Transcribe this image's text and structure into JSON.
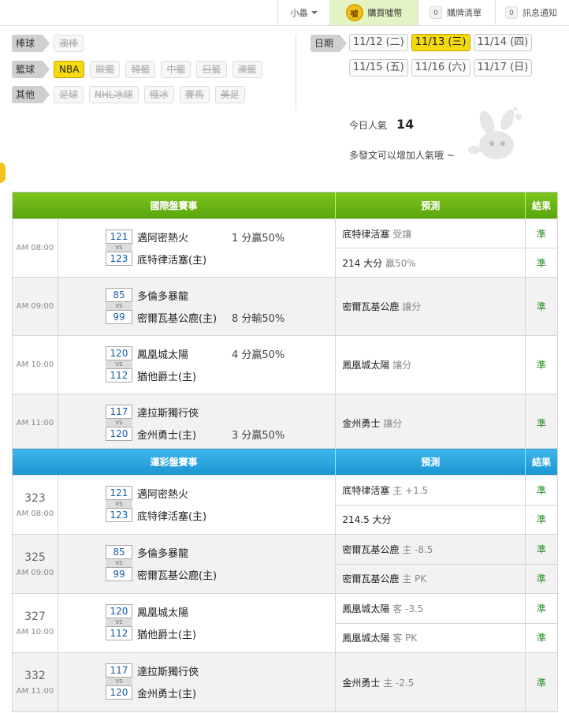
{
  "topbar": {
    "user": "小畾",
    "buy": "購買噓幣",
    "buy_coin": "噓",
    "list_count": "0",
    "list": "購牌清單",
    "msg_count": "0",
    "msg": "訊息通知"
  },
  "categories": [
    {
      "label": "棒球",
      "items": [
        {
          "t": "澳棒",
          "on": false
        }
      ]
    },
    {
      "label": "籃球",
      "items": [
        {
          "t": "NBA",
          "on": true
        },
        {
          "t": "歐籃",
          "on": false
        },
        {
          "t": "韓籃",
          "on": false
        },
        {
          "t": "中籃",
          "on": false
        },
        {
          "t": "日籃",
          "on": false
        },
        {
          "t": "澳籃",
          "on": false
        }
      ]
    },
    {
      "label": "其他",
      "items": [
        {
          "t": "足球",
          "on": false
        },
        {
          "t": "NHL冰球",
          "on": false
        },
        {
          "t": "俄冰",
          "on": false
        },
        {
          "t": "賽馬",
          "on": false
        },
        {
          "t": "美足",
          "on": false
        }
      ]
    }
  ],
  "date_label": "日期",
  "dates": [
    {
      "t": "11/12 (二)",
      "on": false
    },
    {
      "t": "11/13 (三)",
      "on": true
    },
    {
      "t": "11/14 (四)",
      "on": false
    },
    {
      "t": "11/15 (五)",
      "on": false
    },
    {
      "t": "11/16 (六)",
      "on": false
    },
    {
      "t": "11/17 (日)",
      "on": false
    }
  ],
  "popularity": {
    "label": "今日人氣",
    "value": "14",
    "hint": "多發文可以增加人氣哦 ~"
  },
  "intl": {
    "title": "國際盤賽事",
    "pred": "預測",
    "res": "結果",
    "games": [
      {
        "time": "AM 08:00",
        "s1": "121",
        "s2": "123",
        "vs": "VS",
        "t1": "邁阿密熱火",
        "t2": "底特律活塞(主)",
        "n1": "1 分贏50%",
        "n2": "",
        "preds": [
          {
            "main": "底特律活塞",
            "sub": "受讓",
            "res": "準"
          },
          {
            "main": "214 大分",
            "sub": "贏50%",
            "res": "準"
          }
        ],
        "shade": false
      },
      {
        "time": "AM 09:00",
        "s1": "85",
        "s2": "99",
        "vs": "VS",
        "t1": "多倫多暴龍",
        "t2": "密爾瓦基公鹿(主)",
        "n1": "",
        "n2": "8 分輸50%",
        "preds": [
          {
            "main": "密爾瓦基公鹿",
            "sub": "讓分",
            "res": "準"
          }
        ],
        "shade": true
      },
      {
        "time": "AM 10:00",
        "s1": "120",
        "s2": "112",
        "vs": "VS",
        "t1": "鳳凰城太陽",
        "t2": "猶他爵士(主)",
        "n1": "4 分贏50%",
        "n2": "",
        "preds": [
          {
            "main": "鳳凰城太陽",
            "sub": "讓分",
            "res": "準"
          }
        ],
        "shade": false
      },
      {
        "time": "AM 11:00",
        "s1": "117",
        "s2": "120",
        "vs": "VS",
        "t1": "達拉斯獨行俠",
        "t2": "金州勇士(主)",
        "n1": "",
        "n2": "3 分贏50%",
        "preds": [
          {
            "main": "金州勇士",
            "sub": "讓分",
            "res": "準"
          }
        ],
        "shade": true
      }
    ]
  },
  "lottery": {
    "title": "運彩盤賽事",
    "pred": "預測",
    "res": "結果",
    "games": [
      {
        "gid": "323",
        "time": "AM 08:00",
        "s1": "121",
        "s2": "123",
        "vs": "VS",
        "t1": "邁阿密熱火",
        "t2": "底特律活塞(主)",
        "preds": [
          {
            "main": "底特律活塞",
            "sub": "主 +1.5",
            "res": "準"
          },
          {
            "main": "214.5 大分",
            "sub": "",
            "res": "準"
          }
        ],
        "shade": false
      },
      {
        "gid": "325",
        "time": "AM 09:00",
        "s1": "85",
        "s2": "99",
        "vs": "VS",
        "t1": "多倫多暴龍",
        "t2": "密爾瓦基公鹿(主)",
        "preds": [
          {
            "main": "密爾瓦基公鹿",
            "sub": "主 -8.5",
            "res": "準"
          },
          {
            "main": "密爾瓦基公鹿",
            "sub": "主 PK",
            "res": "準"
          }
        ],
        "shade": true
      },
      {
        "gid": "327",
        "time": "AM 10:00",
        "s1": "120",
        "s2": "112",
        "vs": "VS",
        "t1": "鳳凰城太陽",
        "t2": "猶他爵士(主)",
        "preds": [
          {
            "main": "鳳凰城太陽",
            "sub": "客 -3.5",
            "res": "準"
          },
          {
            "main": "鳳凰城太陽",
            "sub": "客 PK",
            "res": "準"
          }
        ],
        "shade": false
      },
      {
        "gid": "332",
        "time": "AM 11:00",
        "s1": "117",
        "s2": "120",
        "vs": "VS",
        "t1": "達拉斯獨行俠",
        "t2": "金州勇士(主)",
        "preds": [
          {
            "main": "金州勇士",
            "sub": "主 -2.5",
            "res": "準"
          }
        ],
        "shade": true
      }
    ]
  }
}
